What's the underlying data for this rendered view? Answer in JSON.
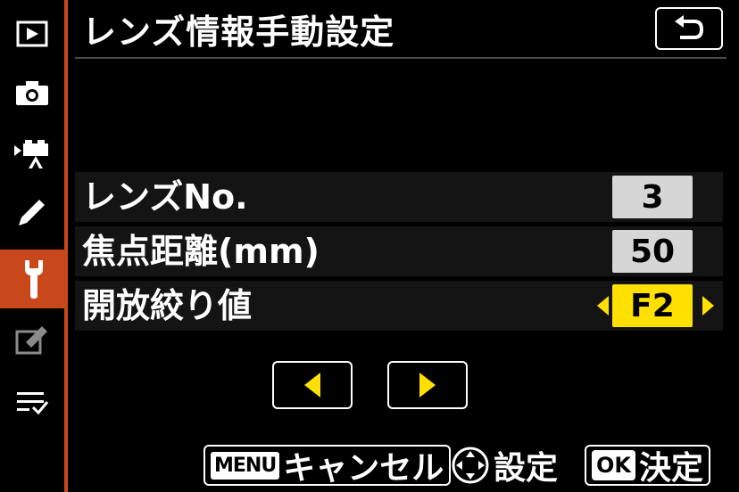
{
  "header": {
    "title": "レンズ情報手動設定"
  },
  "sidebar": {
    "items": [
      {
        "icon": "playback-icon"
      },
      {
        "icon": "camera-icon"
      },
      {
        "icon": "movie-icon"
      },
      {
        "icon": "pencil-icon"
      },
      {
        "icon": "wrench-icon",
        "active": true
      },
      {
        "icon": "retouch-icon"
      },
      {
        "icon": "my-menu-icon"
      }
    ],
    "accent_color": "#c9481b"
  },
  "rows": [
    {
      "label": "レンズNo.",
      "value": "3",
      "selected": false
    },
    {
      "label": "焦点距離(mm)",
      "value": "50",
      "selected": false
    },
    {
      "label": "開放絞り値",
      "value": "F2",
      "selected": true
    }
  ],
  "footer": {
    "cancel_key": "MENU",
    "cancel_label": "キャンセル",
    "set_label": "設定",
    "ok_key": "OK",
    "ok_label": "決定"
  },
  "colors": {
    "highlight": "#ffe000",
    "value_bg": "#d6d6d6"
  }
}
